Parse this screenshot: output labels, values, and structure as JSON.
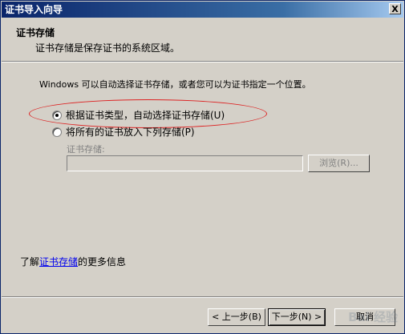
{
  "window": {
    "title": "证书导入向导",
    "close_glyph": "X"
  },
  "header": {
    "title": "证书存储",
    "subtitle": "证书存储是保存证书的系统区域。"
  },
  "body": {
    "intro": "Windows 可以自动选择证书存储，或者您可以为证书指定一个位置。",
    "options": [
      {
        "label": "根据证书类型，自动选择证书存储(U)",
        "checked": true
      },
      {
        "label": "将所有的证书放入下列存储(P)",
        "checked": false
      }
    ],
    "store_label": "证书存储:",
    "store_value": "",
    "browse_label": "浏览(R)..."
  },
  "learn_more": {
    "prefix": "了解",
    "link": "证书存储",
    "suffix": "的更多信息"
  },
  "buttons": {
    "back": "< 上一步(B)",
    "next": "下一步(N) >",
    "cancel": "取消"
  },
  "watermark": {
    "text": "Bai 经验"
  },
  "colors": {
    "titlebar_start": "#0a246a",
    "titlebar_end": "#a6caf0",
    "dialog_bg": "#d4d0c8",
    "highlight_ellipse": "#dd2222",
    "link": "#0000ee"
  }
}
